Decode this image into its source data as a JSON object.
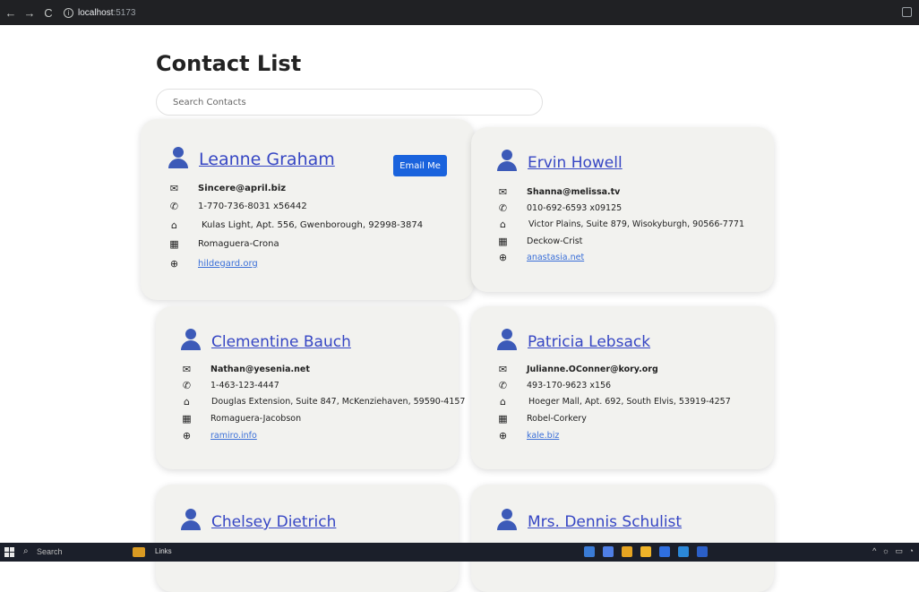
{
  "browser": {
    "url_host": "localhost",
    "url_port": ":5173"
  },
  "page": {
    "title": "Contact List",
    "search_placeholder": "Search Contacts"
  },
  "contacts": [
    {
      "name": "Leanne Graham",
      "email": "Sincere@april.biz",
      "phone": "1-770-736-8031 x56442",
      "address": "Kulas Light, Apt. 556, Gwenborough, 92998-3874",
      "company": "Romaguera-Crona",
      "website": "hildegard.org",
      "email_button": "Email Me"
    },
    {
      "name": "Ervin Howell",
      "email": "Shanna@melissa.tv",
      "phone": "010-692-6593 x09125",
      "address": "Victor Plains, Suite 879, Wisokyburgh, 90566-7771",
      "company": "Deckow-Crist",
      "website": "anastasia.net"
    },
    {
      "name": "Clementine Bauch",
      "email": "Nathan@yesenia.net",
      "phone": "1-463-123-4447",
      "address": "Douglas Extension, Suite 847, McKenziehaven, 59590-4157",
      "company": "Romaguera-Jacobson",
      "website": "ramiro.info"
    },
    {
      "name": "Patricia Lebsack",
      "email": "Julianne.OConner@kory.org",
      "phone": "493-170-9623 x156",
      "address": "Hoeger Mall, Apt. 692, South Elvis, 53919-4257",
      "company": "Robel-Corkery",
      "website": "kale.biz"
    },
    {
      "name": "Chelsey Dietrich"
    },
    {
      "name": "Mrs. Dennis Schulist"
    }
  ],
  "taskbar": {
    "search_label": "Search",
    "links_label": "Links"
  },
  "colors": {
    "accent_link": "#3646c4",
    "button": "#1a63dd",
    "card_bg": "#f2f2ef"
  }
}
